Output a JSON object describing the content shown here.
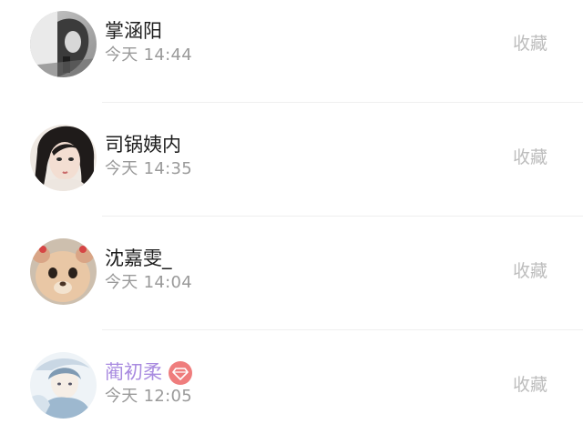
{
  "contacts": [
    {
      "name": "掌涵阳",
      "time": "今天 14:44",
      "action": "收藏",
      "vip": false
    },
    {
      "name": "司锅姨内",
      "time": "今天 14:35",
      "action": "收藏",
      "vip": false
    },
    {
      "name": "沈嘉雯_",
      "time": "今天 14:04",
      "action": "收藏",
      "vip": false
    },
    {
      "name": "蔺初柔",
      "time": "今天 12:05",
      "action": "收藏",
      "vip": true
    }
  ],
  "colors": {
    "name_text": "#1d1d1d",
    "vip_name": "#a98be0",
    "time_text": "#9a9a9a",
    "action_text": "#bdbdbd",
    "vip_badge": "#ef7d7d"
  },
  "icons": {
    "vip_badge": "diamond-icon"
  }
}
